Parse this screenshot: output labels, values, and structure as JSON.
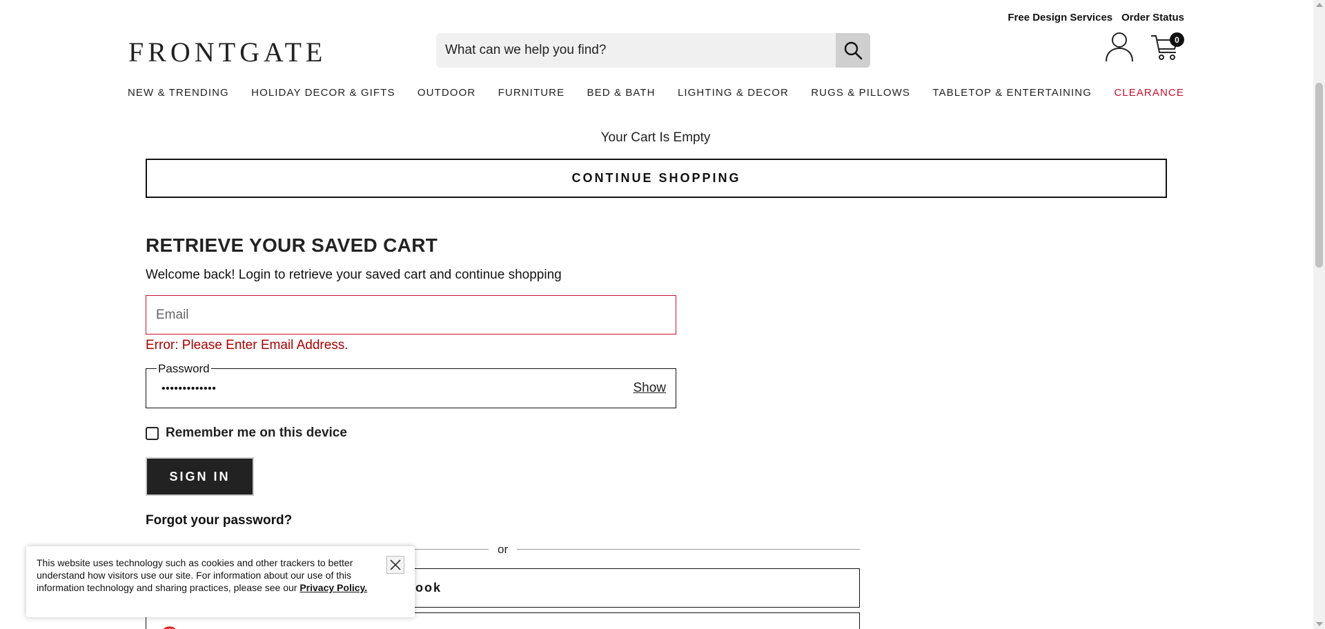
{
  "header": {
    "util_links": [
      "Free Design Services",
      "Order Status"
    ],
    "logo": "FRONTGATE",
    "search_placeholder": "What can we help you find?",
    "cart_count": "0"
  },
  "nav": {
    "items": [
      "NEW & TRENDING",
      "HOLIDAY DECOR & GIFTS",
      "OUTDOOR",
      "FURNITURE",
      "BED & BATH",
      "LIGHTING & DECOR",
      "RUGS & PILLOWS",
      "TABLETOP & ENTERTAINING"
    ],
    "clearance": "CLEARANCE",
    "clearance_color": "#c8102e"
  },
  "cart": {
    "empty_text": "Your Cart Is Empty",
    "continue_label": "CONTINUE SHOPPING"
  },
  "saved_cart": {
    "title": "RETRIEVE YOUR SAVED CART",
    "subtitle": "Welcome back! Login to retrieve your saved cart and continue shopping",
    "email_placeholder": "Email",
    "email_error": "Error: Please Enter Email Address.",
    "password_label": "Password",
    "password_value": "•••••••••••••",
    "show_label": "Show",
    "remember_label": "Remember me on this device",
    "signin_label": "SIGN IN",
    "forgot_label": "Forgot your password?",
    "or_label": "or",
    "facebook_label": "ook",
    "google_label": ""
  },
  "cookie": {
    "text": "This website uses technology such as cookies and other trackers to better understand how visitors use our site. For information about our use of this information technology and sharing practices, please see our",
    "link_label": "Privacy Policy."
  },
  "colors": {
    "error": "#c8102e",
    "button_dark": "#222222"
  }
}
